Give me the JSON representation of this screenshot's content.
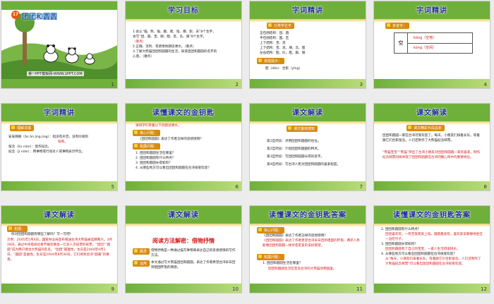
{
  "slides": [
    {
      "number": "1",
      "lesson_number": "17",
      "title": "团团和圆圆",
      "footer": "第一PPT模板网-WWW.1PPT.COM"
    },
    {
      "number": "2",
      "title": "学习目标",
      "lines": [
        "1.会认“临、熊、猴、搬、爬、墙、撑、影、去”8个生字，",
        "会写“团、圆、宝、朋、胆、友、队、跟”8个生字。",
        "（重点）",
        "2.正确、流利、有感情地朗读课文。（重点）",
        "3.了解大熊猫团团和圆圆的生活，知道团团和圆圆的名字的",
        "心意。（难点）"
      ]
    },
    {
      "number": "3",
      "title": "字词精讲",
      "tag": "分类学生字",
      "rows": [
        "全包围结构：团、圆",
        "半包围结构：国、区",
        "上下结构：宝、思",
        "上下结构：宝、思、朋、念、胆",
        "左右结构：胆、队、胆、跟、朋"
      ],
      "sub_tag": "易错提示：",
      "pinyin_line": "胆（dǎn）  合影（yǐng）"
    },
    {
      "number": "4",
      "title": "字词精讲",
      "tag": "多音字：",
      "char": "空",
      "readings": [
        "kōng（空地）",
        "kòng（空闲）"
      ]
    },
    {
      "number": "5",
      "title": "字词精讲",
      "tag": "理解词语",
      "lines": [
        "安安静静（ān ān jìng jìng）：指没有声音，没有吵闹和",
        "喧哗。",
        "留念（liú niàn）：留作纪念。",
        "纪念（jì niàn）：用事物或行动对人或事物表示怀念。"
      ]
    },
    {
      "number": "6",
      "title": "读懂课文的金钥匙",
      "intro": "请同学们带着以下问题读课文。",
      "tag1": "核心问题：",
      "core_q": "《团团和圆圆》表达了作者怎样的思想感情？",
      "tag2": "拓展问题：",
      "questions": [
        "1. 团团和圆圆生活在哪里？",
        "2. 团团和圆圆有什么特点？",
        "3. 团团和圆圆长得如何？",
        "4. 从哪些地方可以看出团团和圆圆在台湾很受欢迎？"
      ]
    },
    {
      "number": "7",
      "title": "课文解读",
      "tag": "课文整体感知",
      "lines": [
        "第1自然段：点明团团和圆圆的住址。",
        "第2自然段：介绍团团和圆圆的特点。",
        "第3自然段：写团团和圆圆长得的名字。",
        "第4自然段：写台湾人民对团团和圆圆的喜爱程度。"
      ]
    },
    {
      "number": "8",
      "title": "课文解读",
      "tag": "课文精彩片段品析",
      "para1": "团团和圆圆一家在台湾可受欢迎了。每天，小朋友们排着长队，等着跟它们合影留念。人们还制作了大熊猫纪念邮票。",
      "para2": "“熊猫宝宝”“熊猫”突出了台湾小朋友对团团和圆圆一家的喜爱。制作纪念邮票同样体现了团团和圆圆在台湾同胞心目中的重要地位。"
    },
    {
      "number": "9",
      "title": "课文解读",
      "tag": "拓展：",
      "q": "你对团团和圆圆有哪些了解吗？写一写吧！",
      "answer": "示例：2005年5月4日，国家林业局宣布赠送台湾大熊猫被选精两只。3月28日，通过中央电视台春节联欢晚会一亿多人次投票的投票，“团团”“圆圆”成为两只赠台大熊猫的乳名。“团团”属雄性，生日是2004年9月1日，“圆圆”是雌性，生日是2004年8月30日，它们将到台湾“圆满”的寓意。"
    },
    {
      "number": "10",
      "title": "课文解读",
      "headline": "阅读方法解密：借物抒情",
      "tag1": "概念",
      "concept": "借物抒情是一种通过描写事物来表达自己的思想感情的写作方法。",
      "tag2": "运用",
      "usage": "本文通过写大熊猫团团和圆圆，表达了作者希望台湾早日回到祖国怀抱的情感。"
    },
    {
      "number": "11",
      "title": "读懂课文的金钥匙答案",
      "tag1": "核心问题：",
      "core_q": "《团团和圆圆》表达了作者怎样的思想感情？",
      "core_a": "《团团和圆圆》表达了作者希望台湾早日回到祖国的怀抱，两岸人民能像团团和圆圆一样亲密友爱的美好愿望。",
      "tag2": "拓展问题：",
      "q1": "1. 团团和圆圆生活在哪里？",
      "a1": "团团和圆圆生活在宝岛台湾的大熊猫动物园里。"
    },
    {
      "number": "12",
      "title": "读懂课文的金钥匙答案",
      "items": [
        {
          "q": "2. 团团和圆圆有什么特点？",
          "a": "团团喜欢玩，一有空就爬高上低。圆圆最会玩，喜欢安安静静地坐在一边吃竹子。"
        },
        {
          "q": "3. 团团和圆圆长得如何？",
          "a": "团团和圆圆有了自己的宝宝，一家人生活得很快乐。"
        },
        {
          "q": "4. 从哪些地方可以看出团团和圆圆在台湾很受欢迎？",
          "a": "从“每天，小朋友们排着长队，等着跟它们合影留念。人们还制作了大熊猫纪念邮票”可以看出团团和圆圆在台湾很受欢迎。"
        }
      ]
    }
  ]
}
